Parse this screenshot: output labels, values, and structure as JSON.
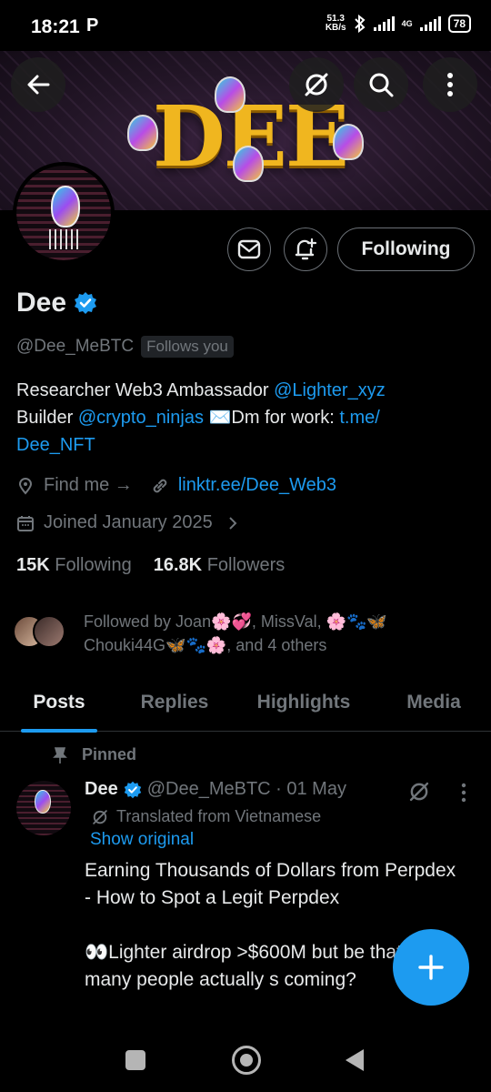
{
  "status_bar": {
    "time": "18:21",
    "notification_icon": "P",
    "netspeed_value": "51.3",
    "netspeed_unit": "KB/s",
    "network": "4G",
    "battery": "78"
  },
  "banner": {
    "text": "DEE"
  },
  "profile": {
    "name": "Dee",
    "handle": "@Dee_MeBTC",
    "follows_you": "Follows you",
    "bio": {
      "t1": "Researcher Web3 Ambassador ",
      "l1": "@Lighter_xyz",
      "t2": "Builder ",
      "l2": "@crypto_ninjas",
      "t3": " ✉️Dm for work: ",
      "l3": "t.me/",
      "l4": "Dee_NFT"
    },
    "location": "Find me →",
    "website": "linktr.ee/Dee_Web3",
    "joined": "Joined January 2025",
    "following_count": "15K",
    "following_label": "Following",
    "followers_count": "16.8K",
    "followers_label": "Followers",
    "followed_by_line1": "Followed by Joan🌸💞, MissVal, 🌸🐾🦋",
    "followed_by_line2": "Chouki44G🦋🐾🌸, and 4 others"
  },
  "actions": {
    "following_button": "Following"
  },
  "tabs": [
    "Posts",
    "Replies",
    "Highlights",
    "Media"
  ],
  "post": {
    "pinned_label": "Pinned",
    "author_name": "Dee",
    "author_handle_date": "@Dee_MeBTC · 01 May",
    "translated": "Translated from Vietnamese",
    "show_original": "Show original",
    "para1": "Earning Thousands of Dollars from Perpdex - How to Spot a Legit Perpdex",
    "para2": "👀Lighter airdrop >$600M but be that, how many people actually s coming?"
  },
  "colors": {
    "accent": "#1d9bf0",
    "muted": "#71767b",
    "text": "#e7e9ea",
    "bg": "#000000"
  },
  "icons": [
    "back-arrow-icon",
    "grok-icon",
    "search-icon",
    "more-vertical-icon",
    "message-icon",
    "notification-bell-plus-icon",
    "verified-badge-icon",
    "location-icon",
    "link-icon",
    "calendar-icon",
    "chevron-right-icon",
    "pin-icon",
    "translate-icon",
    "compose-plus-icon"
  ]
}
